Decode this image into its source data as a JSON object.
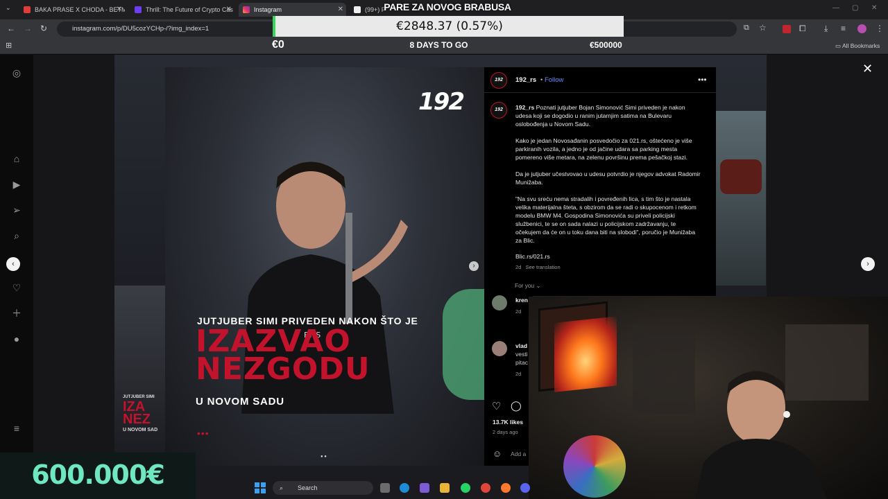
{
  "browser": {
    "tabs": [
      {
        "label": "BAKA PRASE X CHODA - BETMI",
        "active": false
      },
      {
        "label": "Thrill: The Future of Crypto Cas",
        "active": false
      },
      {
        "label": "Instagram",
        "active": true
      },
      {
        "label": "(99+) Find",
        "active": false
      }
    ],
    "url": "instagram.com/p/DU5cozYCHp-/?img_index=1",
    "bookmarks_label": "All Bookmarks"
  },
  "stream_overlay": {
    "title": "PARE ZA NOVOG BRABUSA",
    "amount": "€2848.37 (0.57%)",
    "goal_start": "€0",
    "days_left": "8 DAYS TO GO",
    "goal_end": "€500000",
    "promo": "600.000€"
  },
  "post": {
    "image": {
      "logo": "192",
      "headline_top": "JUTJUBER SIMI PRIVEDEN NAKON ŠTO JE",
      "headline_main_1": "IZAZVAO",
      "headline_main_2": "NEZGODU",
      "headline_bottom": "U NOVOM SADU",
      "dots": "•••",
      "overlay_logo_small": "192"
    },
    "author": {
      "handle": "192_rs",
      "separator": "•",
      "follow_label": "Follow",
      "avatar_text": "192"
    },
    "caption": {
      "handle": "192_rs",
      "p1": "Poznati jutjuber Bojan Simonović Simi priveden je nakon udesa koji se dogodio u ranim jutarnjim satima na Bulevaru oslobođenja u Novom Sadu.",
      "p2": "Kako je jedan Novosađanin posvedočio za 021.rs, oštećeno je više parkiranih vozila, a jedno je od jačine udara sa parking mesta pomereno više metara, na zelenu površinu prema pešačkoj stazi.",
      "p3": "Da je jutjuber učestvovao u udesu potvrdio je njegov advokat Radomir Munižaba.",
      "p4": "\"Na svu sreću nema stradalih i povređenih lica, s tim što je nastala velika materijalna šteta, s obzirom da se radi o skupocenom i retkom modelu BMW M4. Gospodina Simonovića su priveli policijski službenici, te se on sada nalazi u policijskom zadržavanju, te očekujem da će on u toku dana biti na slobodi\", poručio je Munižaba za Blic.",
      "link": "Blic.rs/021.rs",
      "age": "2d",
      "translate": "See translation"
    },
    "for_you": "For you",
    "comments": [
      {
        "user": "kren",
        "text": "",
        "age": "2d"
      },
      {
        "user": "vlad",
        "text": "vesti",
        "text2": "pitac",
        "age": "2d"
      }
    ],
    "likes": "13.7K likes",
    "posted": "2 days ago",
    "add_comment": "Add a"
  },
  "taskbar": {
    "search_label": "Search"
  },
  "icons": [
    "instagram-icon",
    "home-icon",
    "reels-icon",
    "send-icon",
    "search-icon",
    "heart-icon",
    "create-icon",
    "profile-icon",
    "menu-icon",
    "close-icon",
    "chevron-left-icon",
    "chevron-right-icon",
    "more-icon"
  ],
  "colors": {
    "accent_red": "#c3122b",
    "follow_blue": "#6b8cff",
    "progress_green": "#3bd45a",
    "promo_teal": "#6fe8c0"
  }
}
